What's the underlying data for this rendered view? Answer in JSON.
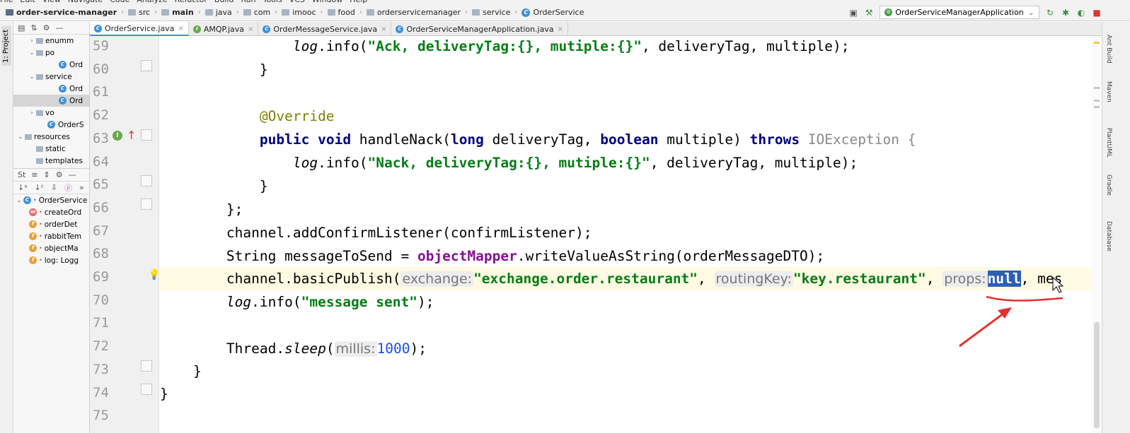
{
  "breadcrumbs": [
    "order-service-manager",
    "src",
    "main",
    "java",
    "com",
    "imooc",
    "food",
    "orderservicemanager",
    "service",
    "OrderService"
  ],
  "run_config": "OrderServiceManagerApplication",
  "tabs": [
    {
      "label": "OrderService.java",
      "icon": "C",
      "active": true
    },
    {
      "label": "AMQP.java",
      "icon": "I",
      "active": false
    },
    {
      "label": "OrderMessageService.java",
      "icon": "C",
      "active": false
    },
    {
      "label": "OrderServiceManagerApplication.java",
      "icon": "C",
      "active": false
    }
  ],
  "left_stripe": {
    "project_label": "1: Project"
  },
  "project_tree": [
    {
      "label": "enumm",
      "indent": 1,
      "kind": "folder",
      "arrow": "›"
    },
    {
      "label": "po",
      "indent": 1,
      "kind": "folder",
      "arrow": "⌄"
    },
    {
      "label": "Ord",
      "indent": 3,
      "kind": "class"
    },
    {
      "label": "service",
      "indent": 1,
      "kind": "folder",
      "arrow": "⌄"
    },
    {
      "label": "Ord",
      "indent": 3,
      "kind": "class"
    },
    {
      "label": "Ord",
      "indent": 3,
      "kind": "class",
      "selected": true
    },
    {
      "label": "vo",
      "indent": 1,
      "kind": "folder",
      "arrow": "›"
    },
    {
      "label": "OrderS",
      "indent": 2,
      "kind": "class"
    },
    {
      "label": "resources",
      "indent": 0,
      "kind": "folder",
      "arrow": "⌄"
    },
    {
      "label": "static",
      "indent": 1,
      "kind": "folder"
    },
    {
      "label": "templates",
      "indent": 1,
      "kind": "folder"
    }
  ],
  "structure_panel": {
    "title": "St",
    "items": [
      {
        "label": "OrderService",
        "badge": "C",
        "indent": 0
      },
      {
        "label": "createOrd",
        "badge": "m",
        "indent": 1
      },
      {
        "label": "orderDet",
        "badge": "f",
        "indent": 1
      },
      {
        "label": "rabbitTem",
        "badge": "f",
        "indent": 1
      },
      {
        "label": "objectMa",
        "badge": "f",
        "indent": 1
      },
      {
        "label": "log: Logg",
        "badge": "f",
        "indent": 1
      }
    ]
  },
  "line_numbers": [
    "59",
    "60",
    "61",
    "62",
    "63",
    "64",
    "65",
    "66",
    "67",
    "68",
    "69",
    "70",
    "71",
    "72",
    "73",
    "74",
    "75"
  ],
  "code": {
    "l59": {
      "log": "log",
      "a": ".info(",
      "s": "\"Ack, deliveryTag:{}, mutiple:{}\"",
      "b": ", deliveryTag, multiple);"
    },
    "l60": "}",
    "l62": "@Override",
    "l63": {
      "kw1": "public",
      "kw2": "void",
      "name": " handleNack(",
      "kw3": "long",
      "p1": " deliveryTag, ",
      "kw4": "boolean",
      "p2": " multiple) ",
      "kw5": "throws",
      "ex": " IOException {"
    },
    "l64": {
      "log": "log",
      "a": ".info(",
      "s": "\"Nack, deliveryTag:{}, mutiple:{}\"",
      "b": ", deliveryTag, multiple);"
    },
    "l65": "}",
    "l66": "};",
    "l67": "channel.addConfirmListener(confirmListener);",
    "l68": {
      "a": "String messageToSend = ",
      "obj": "objectMapper",
      "b": ".writeValueAsString(orderMessageDTO);"
    },
    "l69": {
      "a": "channel.basicPublish(",
      "h1": "exchange:",
      "s1": "\"exchange.order.restaurant\"",
      "c1": ", ",
      "h2": "routingKey:",
      "s2": "\"key.restaurant\"",
      "c2": ", ",
      "h3": "props:",
      "null": "null",
      "c3": ", mes"
    },
    "l70": {
      "log": "log",
      "a": ".info(",
      "s": "\"message sent\"",
      "b": ");"
    },
    "l72": {
      "a": "Thread.",
      "it": "sleep",
      "b": "(",
      "h": "millis:",
      "n": "1000",
      "c": ");"
    },
    "l73": "}",
    "l74": "}"
  },
  "right_stripe": [
    "Ant Build",
    "Maven",
    "PlantUML",
    "Gradle",
    "Database"
  ],
  "colors": {
    "annotation_red": "#e53030",
    "selection": "#2d5fb5"
  }
}
